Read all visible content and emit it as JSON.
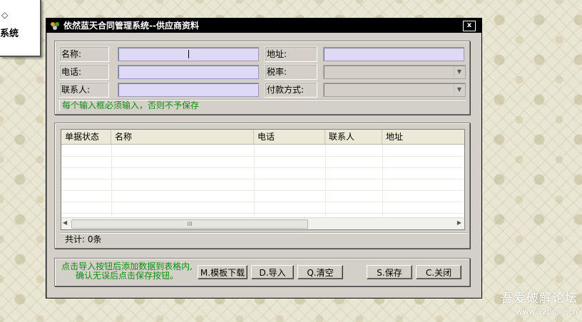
{
  "background_window": {
    "fragment_text": "系统",
    "arrow": "◇"
  },
  "dialog": {
    "title": "依然蓝天合同管理系统--供应商资料",
    "close_label": "x"
  },
  "form": {
    "name_label": "名称:",
    "name_value": "",
    "address_label": "地址:",
    "address_value": "",
    "phone_label": "电话:",
    "phone_value": "",
    "tax_label": "税率:",
    "tax_value": "",
    "contact_label": "联系人:",
    "contact_value": "",
    "payment_label": "付款方式:",
    "payment_value": "",
    "hint": "每个输入框必须输入，否则不予保存"
  },
  "grid": {
    "columns": [
      "单据状态",
      "名称",
      "电话",
      "联系人",
      "地址"
    ],
    "rows": [],
    "scroll_thumb": "III"
  },
  "count_text": "共计: 0条",
  "buttons": {
    "hint_line1": "点击导入按钮后添加数据到表格内,",
    "hint_line2": "确认无误后点击保存按钮。",
    "template": "M.模板下载",
    "import": "D.导入",
    "clear": "Q.清空",
    "save": "S.保存",
    "close": "C.关闭"
  },
  "watermark": {
    "line1": "吾爱破解论坛",
    "line2": "www.52pojie.cn"
  }
}
